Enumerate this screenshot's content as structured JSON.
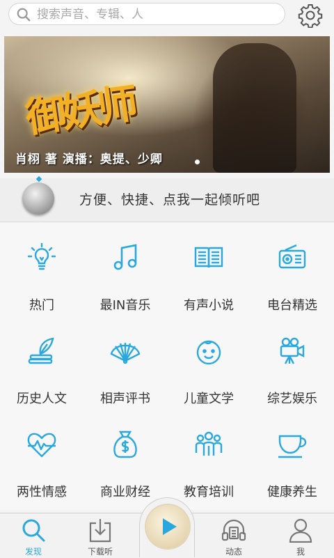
{
  "search": {
    "placeholder": "搜索声音、专辑、人"
  },
  "banner": {
    "title_art": "御妖师",
    "credits": "肖栩   著   演播：奥提、少卿"
  },
  "promo": {
    "text": "方便、快捷、点我一起倾听吧"
  },
  "categories": [
    {
      "label": "热门",
      "icon": "lightbulb-icon"
    },
    {
      "label": "最IN音乐",
      "icon": "music-note-icon"
    },
    {
      "label": "有声小说",
      "icon": "book-icon"
    },
    {
      "label": "电台精选",
      "icon": "radio-icon"
    },
    {
      "label": "历史人文",
      "icon": "quill-books-icon"
    },
    {
      "label": "相声评书",
      "icon": "fan-icon"
    },
    {
      "label": "儿童文学",
      "icon": "child-face-icon"
    },
    {
      "label": "综艺娱乐",
      "icon": "video-camera-icon"
    },
    {
      "label": "两性情感",
      "icon": "heartbeat-icon"
    },
    {
      "label": "商业财经",
      "icon": "money-bag-icon"
    },
    {
      "label": "教育培训",
      "icon": "group-icon"
    },
    {
      "label": "健康养生",
      "icon": "teacup-icon"
    }
  ],
  "tabs": [
    {
      "label": "发现",
      "icon": "search-icon",
      "active": true
    },
    {
      "label": "下载听",
      "icon": "download-icon",
      "active": false
    },
    {
      "label": "动态",
      "icon": "headphones-icon",
      "active": false
    },
    {
      "label": "我",
      "icon": "person-icon",
      "active": false
    }
  ],
  "colors": {
    "accent": "#29a8e0",
    "text": "#333333",
    "background": "#f4f4f4"
  }
}
